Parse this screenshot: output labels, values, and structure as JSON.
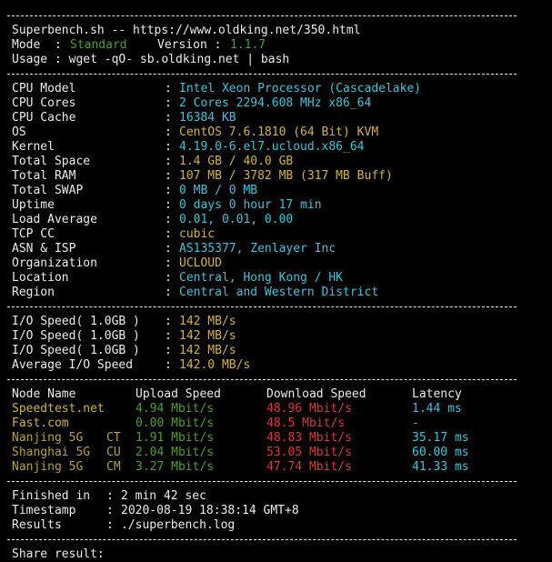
{
  "header": {
    "title": "Superbench.sh -- https://www.oldking.net/350.html",
    "mode_label": "Mode  :",
    "mode_value": "Standard",
    "version_label": "Version :",
    "version_value": "1.1.7",
    "usage": "Usage : wget -qO- sb.oldking.net | bash"
  },
  "system": [
    {
      "label": "CPU Model",
      "value": "Intel Xeon Processor (Cascadelake)",
      "color": "cyan"
    },
    {
      "label": "CPU Cores",
      "value": "2 Cores 2294.608 MHz x86_64",
      "color": "cyan"
    },
    {
      "label": "CPU Cache",
      "value": "16384 KB",
      "color": "cyan"
    },
    {
      "label": "OS",
      "value": "CentOS 7.6.1810 (64 Bit) KVM",
      "color": "yellow"
    },
    {
      "label": "Kernel",
      "value": "4.19.0-6.el7.ucloud.x86_64",
      "color": "cyan"
    },
    {
      "label": "Total Space",
      "value": "1.4 GB / 40.0 GB",
      "color": "yellow"
    },
    {
      "label": "Total RAM",
      "value": "107 MB / 3782 MB (317 MB Buff)",
      "color": "yellow"
    },
    {
      "label": "Total SWAP",
      "value": "0 MB / 0 MB",
      "color": "cyan"
    },
    {
      "label": "Uptime",
      "value": "0 days 0 hour 17 min",
      "color": "cyan"
    },
    {
      "label": "Load Average",
      "value": "0.01, 0.01, 0.00",
      "color": "cyan"
    },
    {
      "label": "TCP CC",
      "value": "cubic",
      "color": "yellow"
    },
    {
      "label": "ASN & ISP",
      "value": "AS135377, Zenlayer Inc",
      "color": "cyan"
    },
    {
      "label": "Organization",
      "value": "UCLOUD",
      "color": "yellow"
    },
    {
      "label": "Location",
      "value": "Central, Hong Kong / HK",
      "color": "cyan"
    },
    {
      "label": "Region",
      "value": "Central and Western District",
      "color": "cyan"
    }
  ],
  "io": [
    {
      "label": "I/O Speed( 1.0GB )",
      "value": "142 MB/s"
    },
    {
      "label": "I/O Speed( 1.0GB )",
      "value": "142 MB/s"
    },
    {
      "label": "I/O Speed( 1.0GB )",
      "value": "142 MB/s"
    },
    {
      "label": "Average I/O Speed",
      "value": "142.0 MB/s"
    }
  ],
  "speed_table": {
    "headers": [
      "Node Name",
      "Upload Speed",
      "Download Speed",
      "Latency"
    ],
    "rows": [
      {
        "name": "Speedtest.net",
        "isp": "",
        "upload": "4.94 Mbit/s",
        "download": "48.96 Mbit/s",
        "latency": "1.44 ms",
        "name_color": "yellow",
        "latency_color": "cyan"
      },
      {
        "name": "Fast.com",
        "isp": "",
        "upload": "0.00 Mbit/s",
        "download": "48.5 Mbit/s",
        "latency": "-",
        "name_color": "yellow",
        "latency_color": "olive"
      },
      {
        "name": "Nanjing 5G",
        "isp": "CT",
        "upload": "1.91 Mbit/s",
        "download": "48.83 Mbit/s",
        "latency": "35.17 ms",
        "name_color": "olive",
        "latency_color": "cyan"
      },
      {
        "name": "Shanghai 5G",
        "isp": "CU",
        "upload": "2.04 Mbit/s",
        "download": "53.05 Mbit/s",
        "latency": "60.00 ms",
        "name_color": "olive",
        "latency_color": "cyan"
      },
      {
        "name": "Nanjing 5G",
        "isp": "CM",
        "upload": "3.27 Mbit/s",
        "download": "47.74 Mbit/s",
        "latency": "41.33 ms",
        "name_color": "olive",
        "latency_color": "cyan"
      }
    ]
  },
  "summary": [
    {
      "label": "Finished in",
      "value": "2 min 42 sec"
    },
    {
      "label": "Timestamp",
      "value": "2020-08-19 18:38:14 GMT+8"
    },
    {
      "label": "Results",
      "value": "./superbench.log"
    }
  ],
  "footer": {
    "share": "Share result:"
  },
  "colors": {
    "background": "#000000",
    "text": "#ececec",
    "cyan": "#3fc3dc",
    "yellow": "#d4b43c",
    "green": "#3ec63e",
    "red": "#d83a34"
  }
}
